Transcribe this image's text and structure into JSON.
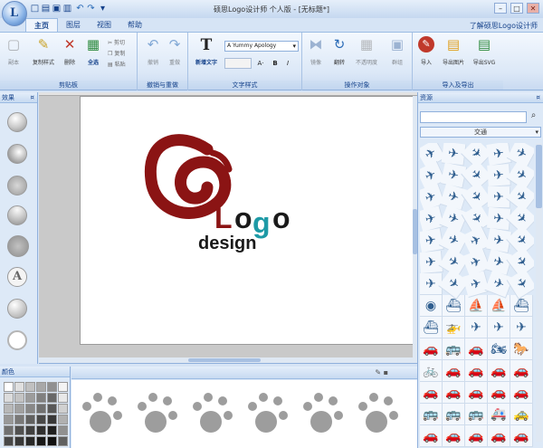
{
  "window": {
    "title": "硕思Logo设计师 个人版 - [无标题*]",
    "help_link": "了解硕思Logo设计师",
    "controls": {
      "min": "–",
      "max": "□",
      "close": "✕"
    }
  },
  "app_button": {
    "glyph": "L"
  },
  "quick_access": [
    {
      "name": "new-icon",
      "glyph": "□"
    },
    {
      "name": "open-icon",
      "glyph": "▤"
    },
    {
      "name": "save-icon",
      "glyph": "▣"
    },
    {
      "name": "print-icon",
      "glyph": "▥"
    },
    {
      "name": "undo-icon",
      "glyph": "↶"
    },
    {
      "name": "redo-icon",
      "glyph": "↷"
    },
    {
      "name": "customize-icon",
      "glyph": "▾"
    }
  ],
  "tabs": [
    {
      "label": "主页",
      "active": true
    },
    {
      "label": "图层",
      "active": false
    },
    {
      "label": "视图",
      "active": false
    },
    {
      "label": "帮助",
      "active": false
    }
  ],
  "ribbon": {
    "clipboard": {
      "label": "剪贴板",
      "buttons": [
        "副本",
        "复制样式",
        "删除",
        "全选"
      ],
      "small": [
        "剪切",
        "复制",
        "粘贴"
      ]
    },
    "undo_redo": {
      "label": "撤销与重做",
      "buttons": [
        "撤销",
        "重做"
      ]
    },
    "text_style": {
      "label": "文字样式",
      "new_text": "新增文字",
      "font_name": "A Yummy Apology",
      "font_size": "",
      "format_buttons": [
        "A·",
        "B",
        "I"
      ]
    },
    "operations": {
      "label": "操作对象",
      "buttons": [
        "镜像",
        "翻转",
        "不透明度",
        "群组"
      ]
    },
    "import_export": {
      "label": "导入及导出",
      "buttons": [
        "导入",
        "导出图片",
        "导出SVG"
      ]
    }
  },
  "effects_panel": {
    "title": "效果",
    "pin": "¤",
    "text_effect_glyph": "A"
  },
  "canvas": {
    "logo_word": "Logo",
    "logo_sub": "design",
    "colors": {
      "spiral": "#8b1414",
      "teal": "#1e9aa6",
      "text": "#1a1a1a"
    }
  },
  "shapes_panel": {
    "title": "资源",
    "pin": "¤",
    "search_placeholder": "",
    "category": "交通",
    "items": [
      "✈",
      "✈",
      "✈",
      "✈",
      "✈",
      "✈",
      "✈",
      "✈",
      "✈",
      "✈",
      "✈",
      "✈",
      "✈",
      "✈",
      "✈",
      "✈",
      "✈",
      "✈",
      "✈",
      "✈",
      "✈",
      "✈",
      "✈",
      "✈",
      "✈",
      "✈",
      "✈",
      "✈",
      "✈",
      "✈",
      "✈",
      "✈",
      "✈",
      "✈",
      "✈",
      "◉",
      "⛴",
      "⛵",
      "⛵",
      "⛴",
      "⛴",
      "🚁",
      "✈",
      "✈",
      "✈",
      "🚗",
      "🚌",
      "🚗",
      "🏍",
      "🐎",
      "🚲",
      "🚗",
      "🚗",
      "🚗",
      "🚗",
      "🚗",
      "🚗",
      "🚗",
      "🚗",
      "🚗",
      "🚌",
      "🚌",
      "🚌",
      "🚑",
      "🚕",
      "🚗",
      "🚗",
      "🚗",
      "🚗",
      "🚗"
    ]
  },
  "colors_panel": {
    "title": "颜色",
    "swatches": [
      "#ffffff",
      "#e0e0e0",
      "#c0c0c0",
      "#a8a8a8",
      "#909090",
      "#f4f4f4",
      "#dcdcdc",
      "#c4c4c4",
      "#9c9c9c",
      "#808080",
      "#686868",
      "#e8e8e8",
      "#b8b8b8",
      "#a0a0a0",
      "#888888",
      "#707070",
      "#585858",
      "#d0d0d0",
      "#989898",
      "#787878",
      "#606060",
      "#484848",
      "#383838",
      "#b0b0b0",
      "#707070",
      "#505050",
      "#404040",
      "#303030",
      "#202020",
      "#909090",
      "#484848",
      "#383838",
      "#282828",
      "#181818",
      "#101010",
      "#606060"
    ]
  },
  "bottom_panel": {
    "tools": "✎ ▪"
  }
}
